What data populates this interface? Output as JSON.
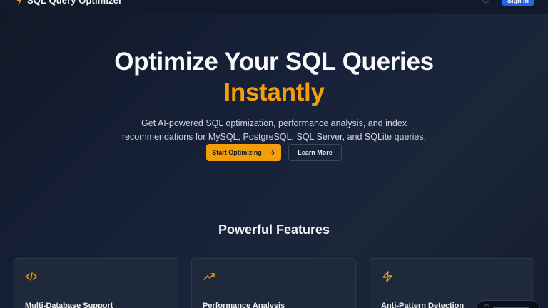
{
  "header": {
    "brand_name": "SQL Query Optimizer",
    "sign_in_label": "Sign In"
  },
  "hero": {
    "title_line1": "Optimize Your SQL Queries",
    "title_line2": "Instantly",
    "subtitle": "Get AI-powered SQL optimization, performance analysis, and index recommendations for MySQL, PostgreSQL, SQL Server, and SQLite queries.",
    "primary_cta": "Start Optimizing",
    "secondary_cta": "Learn More"
  },
  "features": {
    "title": "Powerful Features",
    "items": [
      {
        "icon": "code-icon",
        "title": "Multi-Database Support"
      },
      {
        "icon": "trending-up-icon",
        "title": "Performance Analysis"
      },
      {
        "icon": "lightning-icon",
        "title": "Anti-Pattern Detection"
      }
    ]
  },
  "colors": {
    "accent": "#f59e0b",
    "primary_blue": "#2563eb",
    "background": "#131c2d",
    "card": "#1e293b"
  }
}
